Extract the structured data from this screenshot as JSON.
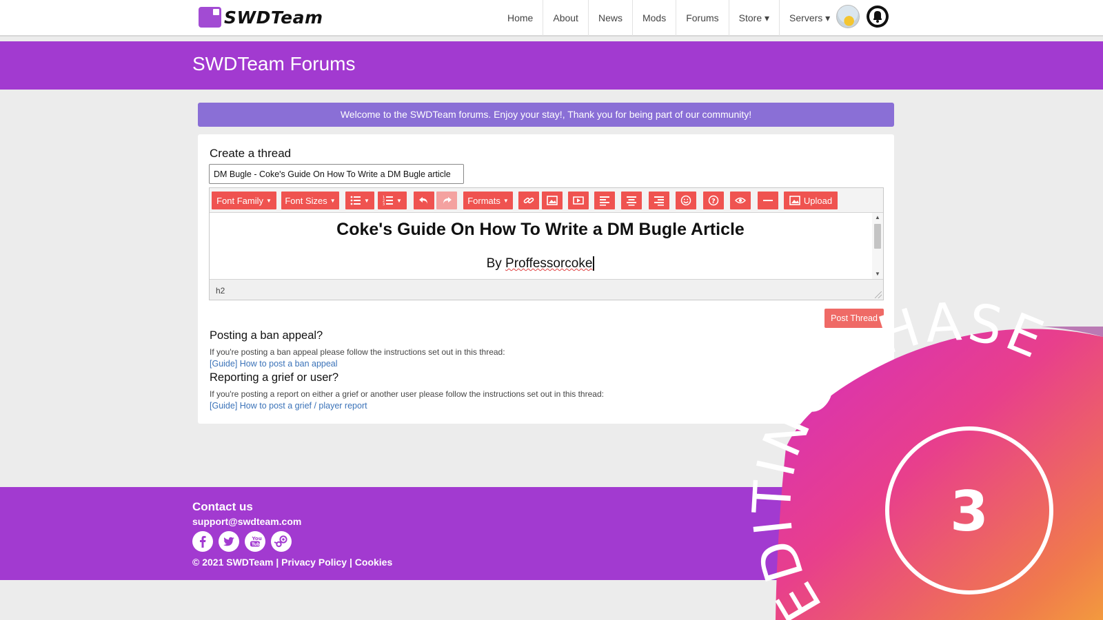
{
  "nav": {
    "brand": "SWDTeam",
    "links": [
      "Home",
      "About",
      "News",
      "Mods",
      "Forums",
      "Store ▾",
      "Servers ▾"
    ]
  },
  "banner": {
    "title": "SWDTeam Forums"
  },
  "welcome": "Welcome to the SWDTeam forums. Enjoy your stay!, Thank you for being part of our community!",
  "form": {
    "heading": "Create a thread",
    "title_value": "DM Bugle - Coke's Guide On How To Write a DM Bugle article",
    "toolbar": {
      "font_family": "Font Family",
      "font_sizes": "Font Sizes",
      "formats": "Formats",
      "upload": "Upload"
    },
    "content": {
      "heading": "Coke's Guide On How To Write a DM Bugle Article",
      "by_prefix": "By ",
      "author": "Proffessorcoke"
    },
    "status_path": "h2",
    "post_button": "Post Thread"
  },
  "info": {
    "ban_heading": "Posting a ban appeal?",
    "ban_text": "If you're posting a ban appeal please follow the instructions set out in this thread:",
    "ban_link": "[Guide] How to post a ban appeal",
    "grief_heading": "Reporting a grief or user?",
    "grief_text": "If you're posting a report on either a grief or another user please follow the instructions set out in this thread:",
    "grief_link": "[Guide] How to post a grief / player report"
  },
  "footer": {
    "contact_heading": "Contact us",
    "email": "support@swdteam.com",
    "copyright": "© 2021 SWDTeam",
    "privacy": "Privacy Policy",
    "cookies": "Cookies",
    "social_icons": [
      "facebook-icon",
      "twitter-icon",
      "youtube-icon",
      "steam-icon"
    ]
  },
  "overlay": {
    "arc_text": "EDITING PHASE",
    "number": "3"
  },
  "colors": {
    "brand_purple": "#a23ad0",
    "welcome_bar": "#8a6fd6",
    "toolbar_red": "#ef5350",
    "post_button": "#ef6a66",
    "link_blue": "#3a72b8"
  }
}
